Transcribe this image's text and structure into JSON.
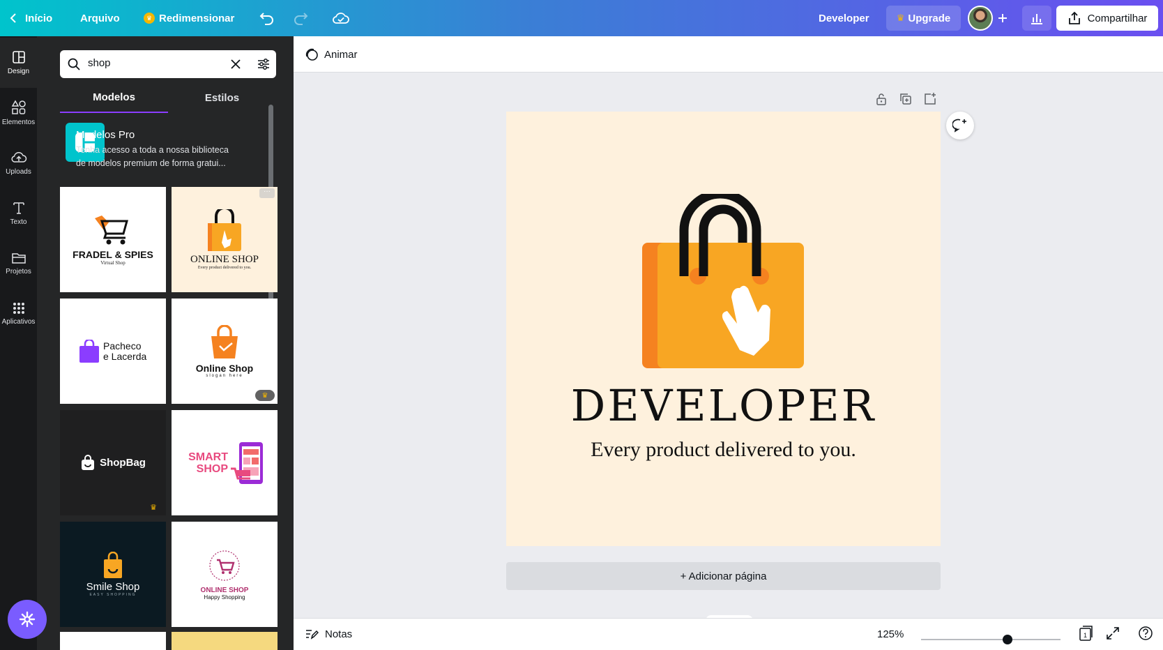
{
  "topbar": {
    "home_label": "Início",
    "file_label": "Arquivo",
    "resize_label": "Redimensionar",
    "user_name": "Developer",
    "upgrade_label": "Upgrade",
    "share_label": "Compartilhar"
  },
  "rail": {
    "items": [
      {
        "label": "Design",
        "icon": "design-icon"
      },
      {
        "label": "Elementos",
        "icon": "elements-icon"
      },
      {
        "label": "Uploads",
        "icon": "upload-cloud-icon"
      },
      {
        "label": "Texto",
        "icon": "text-icon"
      },
      {
        "label": "Projetos",
        "icon": "folder-icon"
      },
      {
        "label": "Aplicativos",
        "icon": "apps-grid-icon"
      }
    ]
  },
  "panel": {
    "search_value": "shop",
    "tabs": [
      "Modelos",
      "Estilos"
    ],
    "pro_banner": {
      "title": "Modelos Pro",
      "description": "Tenha acesso a toda a nossa biblioteca de modelos premium de forma gratui..."
    },
    "templates": [
      {
        "title": "FRADEL & SPIES",
        "subtitle": "Virtual Shop"
      },
      {
        "title": "ONLINE SHOP",
        "subtitle": "Every product delivered to you."
      },
      {
        "title": "Pacheco e Lacerda",
        "subtitle": ""
      },
      {
        "title": "Online Shop",
        "subtitle": "slogan here"
      },
      {
        "title": "ShopBag",
        "subtitle": ""
      },
      {
        "title": "SMART SHOP",
        "subtitle": ""
      },
      {
        "title": "Smile Shop",
        "subtitle": "EASY SHOPPING"
      },
      {
        "title": "ONLINE SHOP",
        "subtitle": "Happy Shopping"
      }
    ]
  },
  "canvas": {
    "animate_label": "Animar",
    "design_title": "DEVELOPER",
    "design_tagline": "Every product delivered to you.",
    "add_page_label": "+ Adicionar página"
  },
  "bottombar": {
    "notes_label": "Notas",
    "zoom_label": "125%",
    "zoom_fraction": 0.62,
    "page_count": "1"
  },
  "colors": {
    "accent": "#8b3dff",
    "bag_orange": "#f8a623",
    "bag_dark_orange": "#f58220",
    "page_bg": "#fef1dd"
  }
}
